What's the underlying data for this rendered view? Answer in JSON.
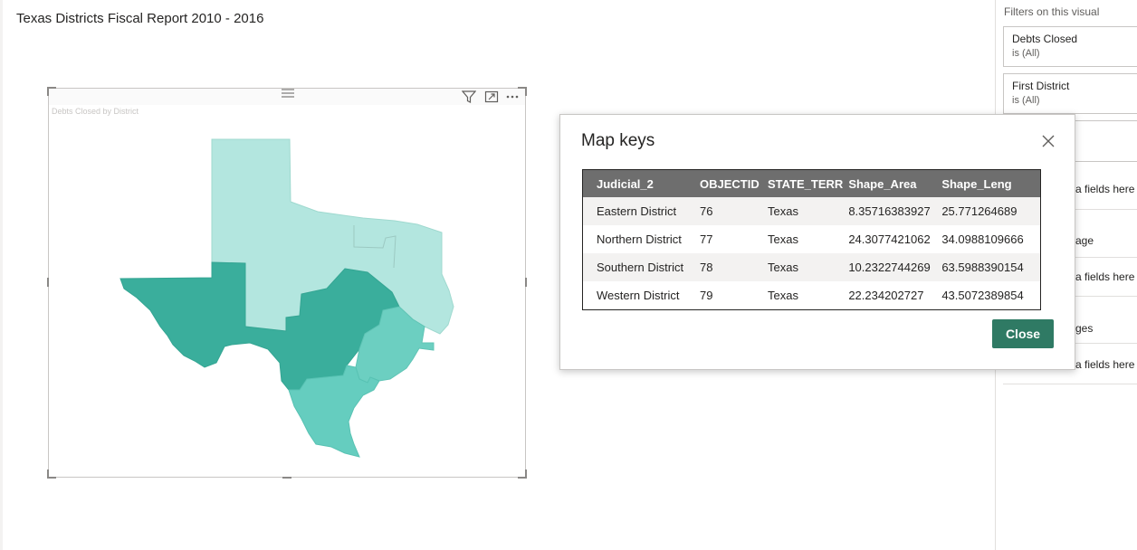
{
  "report": {
    "title": "Texas Districts Fiscal Report 2010 - 2016"
  },
  "visual": {
    "title": "Debts Closed by District",
    "icons": [
      "drag-handle-icon",
      "filter-icon",
      "focus-mode-icon",
      "more-options-icon"
    ],
    "districts": [
      {
        "name": "Northern District",
        "color": "#b3e6df"
      },
      {
        "name": "Western District",
        "color": "#3aae9c"
      },
      {
        "name": "Eastern District",
        "color": "#6ccfc1"
      },
      {
        "name": "Southern District",
        "color": "#65cdbf"
      }
    ]
  },
  "filters": {
    "heading": "Filters on this visual",
    "cards": [
      {
        "name": "Debts Closed",
        "value": "is (All)"
      },
      {
        "name": "First District",
        "value": "is (All)"
      }
    ],
    "partials": [
      "a fields here",
      "age",
      "a fields here",
      "ges",
      "a fields here"
    ]
  },
  "dialog": {
    "title": "Map keys",
    "close_label": "Close",
    "columns": [
      "Judicial_2",
      "OBJECTID",
      "STATE_TERR",
      "Shape_Area",
      "Shape_Leng"
    ],
    "rows": [
      [
        "Eastern District",
        "76",
        "Texas",
        "8.35716383927",
        "25.771264689"
      ],
      [
        "Northern District",
        "77",
        "Texas",
        "24.3077421062",
        "34.0988109666"
      ],
      [
        "Southern District",
        "78",
        "Texas",
        "10.2322744269",
        "63.5988390154"
      ],
      [
        "Western District",
        "79",
        "Texas",
        "22.234202727",
        "43.5072389854"
      ]
    ]
  },
  "colors": {
    "accent": "#2f7a64",
    "table_header": "#6e6e6e"
  }
}
